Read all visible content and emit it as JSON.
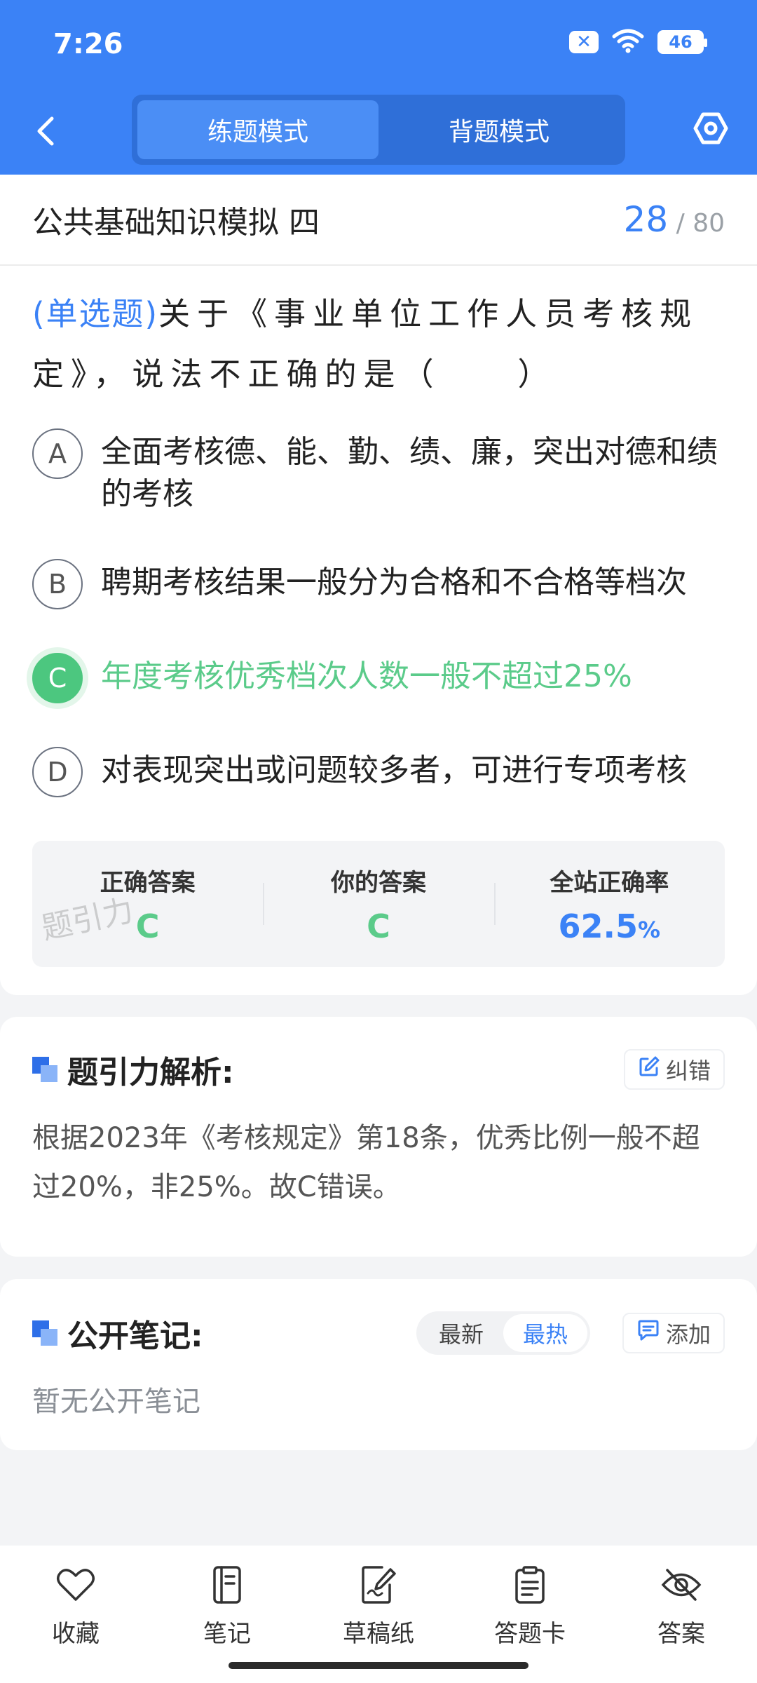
{
  "status_bar": {
    "time": "7:26",
    "battery": "46"
  },
  "nav": {
    "tabs": [
      {
        "label": "练题模式",
        "active": true
      },
      {
        "label": "背题模式",
        "active": false
      }
    ]
  },
  "exam": {
    "title": "公共基础知识模拟 四",
    "current": "28",
    "separator": "/",
    "total": "80"
  },
  "question": {
    "type_label": "(单选题)",
    "text": "关于《事业单位工作人员考核规定》，说法不正确的是（　　）",
    "options": [
      {
        "letter": "A",
        "text": "全面考核德、能、勤、绩、廉，突出对德和绩的考核"
      },
      {
        "letter": "B",
        "text": "聘期考核结果一般分为合格和不合格等档次"
      },
      {
        "letter": "C",
        "text": "年度考核优秀档次人数一般不超过25%",
        "state": "correct"
      },
      {
        "letter": "D",
        "text": "对表现突出或问题较多者，可进行专项考核"
      }
    ]
  },
  "answer_panel": {
    "correct_label": "正确答案",
    "correct_value": "C",
    "yours_label": "你的答案",
    "yours_value": "C",
    "rate_label": "全站正确率",
    "rate_value": "62.5",
    "rate_unit": "%",
    "watermark": "题引力"
  },
  "analysis": {
    "title": "题引力解析:",
    "report_label": "纠错",
    "text": "根据2023年《考核规定》第18条，优秀比例一般不超过20%，非25%。故C错误。"
  },
  "notes": {
    "title": "公开笔记:",
    "sort_options": [
      "最新",
      "最热"
    ],
    "active_sort": "最热",
    "add_label": "添加",
    "empty_text": "暂无公开笔记"
  },
  "bottom_bar": [
    {
      "label": "收藏",
      "icon": "heart-icon"
    },
    {
      "label": "笔记",
      "icon": "notebook-icon"
    },
    {
      "label": "草稿纸",
      "icon": "draft-paper-icon"
    },
    {
      "label": "答题卡",
      "icon": "answer-sheet-icon"
    },
    {
      "label": "答案",
      "icon": "eye-off-icon"
    }
  ],
  "colors": {
    "primary": "#3b82f6",
    "correct": "#4cc77f",
    "background": "#f3f4f6"
  }
}
